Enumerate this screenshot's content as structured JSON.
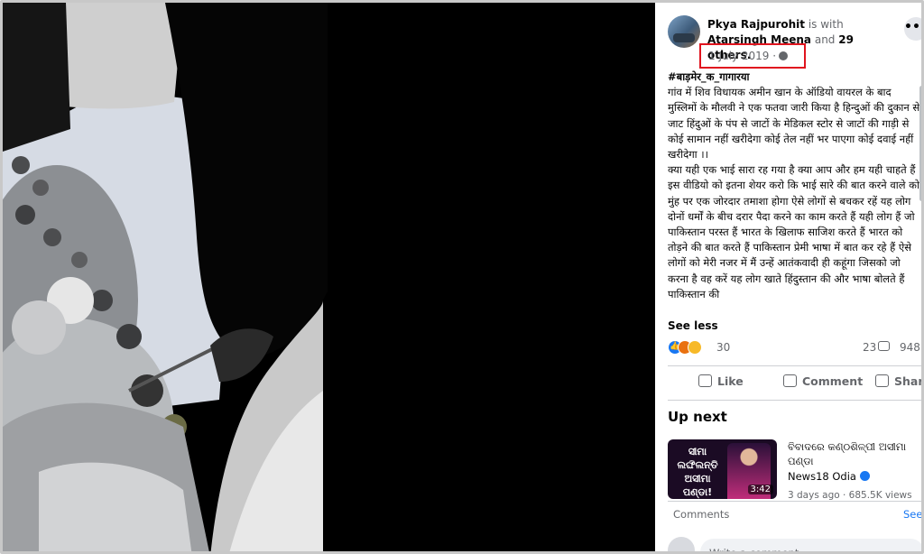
{
  "post": {
    "author": "Pkya Rajpurohit",
    "with_text": "is with",
    "tagged": "Atarsingh Meena",
    "and_text": "and",
    "others": "29 others.",
    "date": "1 July 2019 ·",
    "privacy_icon": "globe-icon",
    "more_icon": "more-dots-icon",
    "hashtag": "#बाड़मेर_क_गागारया",
    "body_1": "गांव में शिव विधायक अमीन खान के ऑडियो वायरल के बाद मुस्लिमों के मौलवी ने एक फतवा जारी किया है हिन्दुओं की दुकान से जाट हिंदुओं के पंप से जाटों के मेडिकल स्टोर से जाटों की गाड़ी से कोई सामान नहीं खरीदेगा कोई तेल नहीं भर पाएगा कोई दवाई नहीं खरीदेगा ।।",
    "body_2": "क्या यही एक भाई सारा रह गया है क्या आप और हम यही चाहते हैं इस वीडियो को इतना शेयर करो कि भाई सारे की बात करने वाले को मुंह पर एक जोरदार तमाशा होगा ऐसे लोगों से बचकर रहें यह लोग दोनों धर्मों के बीच दरार पैदा करने का काम करते हैं यही लोग हैं जो पाकिस्तान परस्त हैं भारत के खिलाफ साजिश करते हैं भारत को तोड़ने की बात करते हैं पाकिस्तान प्रेमी भाषा में बात कर रहे हैं ऐसे लोगों को मेरी नजर में मैं उन्हें आतंकवादी ही कहूंगा जिसको जो करना है वह करें यह लोग खाते हिंदुस्तान की और भाषा बोलते हैं पाकिस्तान की",
    "see_less": "See less",
    "reaction_count": "30",
    "comment_count": "23",
    "share_count": "948 ◦",
    "like_label": "Like",
    "comment_label": "Comment",
    "share_label": "Share"
  },
  "up_next": {
    "heading": "Up next",
    "thumb_text": "ସୀମା ଲଙ୍ଘିଲନ୍ତି ଅସୀମା ପଣ୍ଡା!",
    "duration": "3:42",
    "title": "ବିବାଦରେ କଣ୍ଠଶିଳ୍ପୀ ଅସୀମା ପଣ୍ଡା",
    "channel": "News18 Odia",
    "meta": "3 days ago · 685.5K views"
  },
  "comments": {
    "label": "Comments",
    "see": "See",
    "placeholder": "Write a comment..."
  },
  "colors": {
    "highlight_box": "#e0141e",
    "link": "#1877f2",
    "secondary_text": "#65676b"
  }
}
